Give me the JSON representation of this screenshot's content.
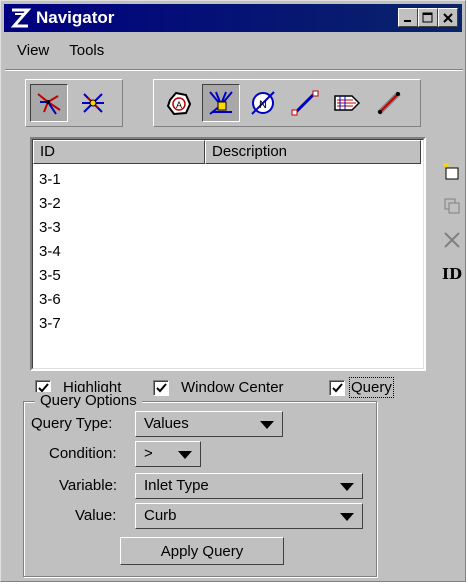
{
  "window": {
    "title": "Navigator"
  },
  "menu": {
    "items": [
      "View",
      "Tools"
    ]
  },
  "toolbar": {
    "left_icons": [
      "network-view-icon",
      "node-view-icon"
    ],
    "right_icons": [
      "area-icon",
      "inlet-icon",
      "node-icon",
      "pipe-icon",
      "gutter-icon",
      "link-icon"
    ]
  },
  "list": {
    "columns": [
      "ID",
      "Description"
    ],
    "rows": [
      {
        "id": "3-1",
        "description": ""
      },
      {
        "id": "3-2",
        "description": ""
      },
      {
        "id": "3-3",
        "description": ""
      },
      {
        "id": "3-4",
        "description": ""
      },
      {
        "id": "3-5",
        "description": ""
      },
      {
        "id": "3-6",
        "description": ""
      },
      {
        "id": "3-7",
        "description": ""
      }
    ]
  },
  "side_tools": {
    "id_label": "ID"
  },
  "checks": {
    "highlight": {
      "label": "Highlight",
      "checked": true
    },
    "window_center": {
      "label": "Window Center",
      "checked": true
    },
    "query": {
      "label": "Query",
      "checked": true
    }
  },
  "query_options": {
    "title": "Query Options",
    "query_type_label": "Query Type:",
    "query_type_value": "Values",
    "condition_label": "Condition:",
    "condition_value": ">",
    "variable_label": "Variable:",
    "variable_value": "Inlet Type",
    "value_label": "Value:",
    "value_value": "Curb",
    "apply_label": "Apply Query"
  }
}
